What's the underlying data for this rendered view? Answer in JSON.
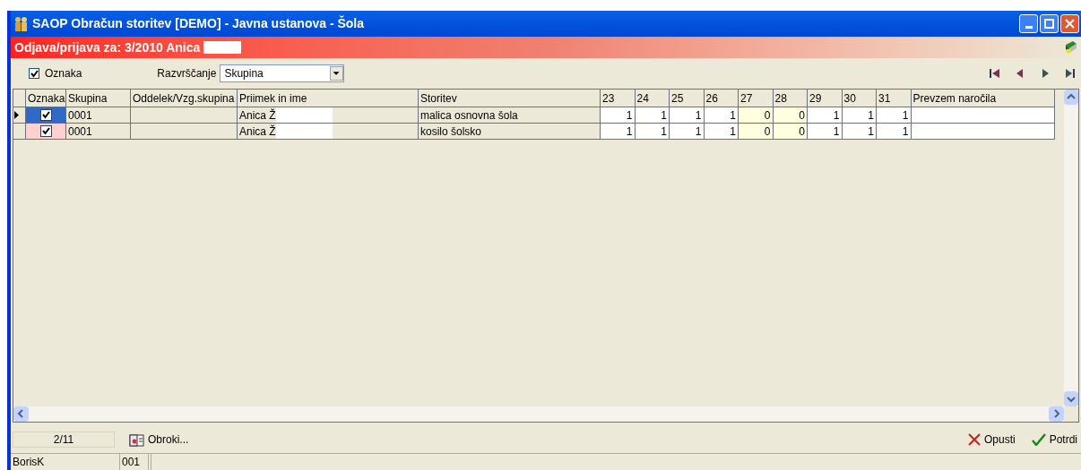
{
  "window": {
    "title": "SAOP Obračun storitev [DEMO] - Javna ustanova - Šola"
  },
  "header": {
    "title": "Odjava/prijava za: 3/2010 Anica"
  },
  "toolbar": {
    "oznaka": {
      "label": "Oznaka",
      "checked": true
    },
    "sort": {
      "label": "Razvrščanje",
      "value": "Skupina"
    }
  },
  "table": {
    "columns": [
      {
        "label": "Oznaka",
        "kind": "check"
      },
      {
        "label": "Skupina",
        "kind": "text"
      },
      {
        "label": "Oddelek/Vzg.skupina",
        "kind": "text"
      },
      {
        "label": "Priimek in ime",
        "kind": "name"
      },
      {
        "label": "Storitev",
        "kind": "text"
      },
      {
        "label": "23",
        "kind": "day",
        "weekend": false
      },
      {
        "label": "24",
        "kind": "day",
        "weekend": false
      },
      {
        "label": "25",
        "kind": "day",
        "weekend": false
      },
      {
        "label": "26",
        "kind": "day",
        "weekend": false
      },
      {
        "label": "27",
        "kind": "day",
        "weekend": true
      },
      {
        "label": "28",
        "kind": "day",
        "weekend": true
      },
      {
        "label": "29",
        "kind": "day",
        "weekend": false
      },
      {
        "label": "30",
        "kind": "day",
        "weekend": false
      },
      {
        "label": "31",
        "kind": "day",
        "weekend": false
      },
      {
        "label": "Prevzem naročila",
        "kind": "text"
      }
    ],
    "rows": [
      {
        "selected": true,
        "checked": true,
        "cells": [
          "",
          "0001",
          "",
          "Anica Ž",
          "malica osnovna šola",
          "1",
          "1",
          "1",
          "1",
          "0",
          "0",
          "1",
          "1",
          "1",
          ""
        ]
      },
      {
        "selected": false,
        "checked": true,
        "cells": [
          "",
          "0001",
          "",
          "Anica Ž",
          "kosilo šolsko",
          "1",
          "1",
          "1",
          "1",
          "0",
          "0",
          "1",
          "1",
          "1",
          ""
        ]
      }
    ]
  },
  "footer": {
    "counter": "2/11",
    "meals_button": "Obroki...",
    "cancel_button": "Opusti",
    "confirm_button": "Potrdi"
  },
  "status_bar": [
    "BorisK",
    "001"
  ]
}
